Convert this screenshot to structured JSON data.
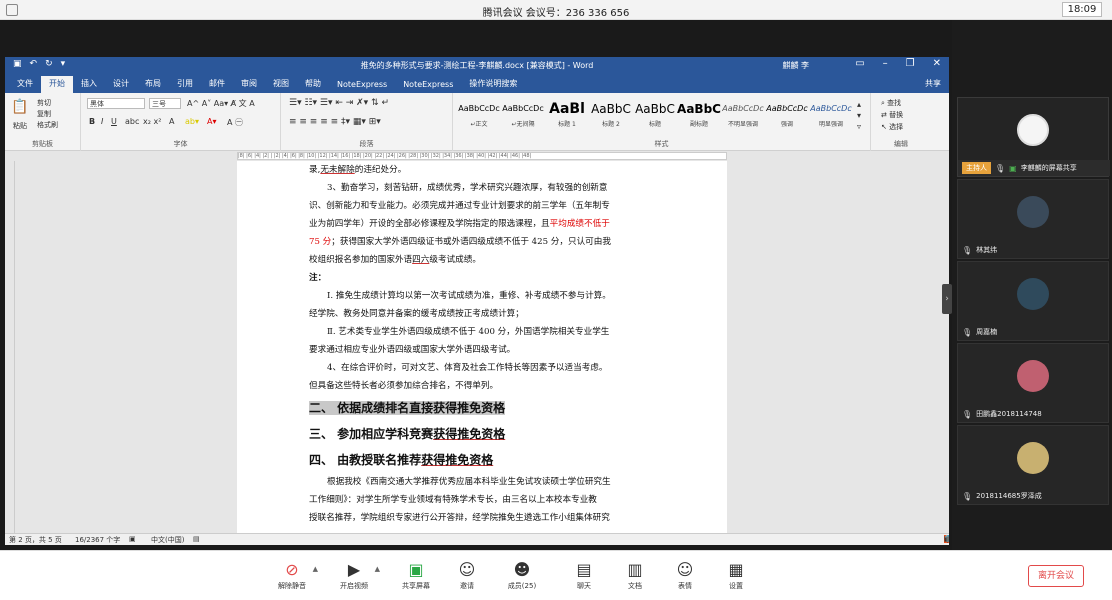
{
  "meeting": {
    "title": "腾讯会议 会议号：236 336 656",
    "clock": "18:09"
  },
  "word": {
    "title": "推免的多种形式与要求-测绘工程-李麒麟.docx [兼容模式] - Word",
    "user": "麒麟 李",
    "tabs": [
      "文件",
      "开始",
      "插入",
      "设计",
      "布局",
      "引用",
      "邮件",
      "审阅",
      "视图",
      "帮助",
      "NoteExpress",
      "NoteExpress",
      "操作说明搜索"
    ],
    "share": "共享",
    "ribbon": {
      "clipboard": {
        "paste": "粘贴",
        "cut": "剪切",
        "copy": "复制",
        "format_painter": "格式刷",
        "label": "剪贴板"
      },
      "font": {
        "name": "黑体",
        "size": "三号",
        "label": "字体"
      },
      "paragraph": {
        "label": "段落"
      },
      "styles": {
        "label": "样式",
        "items": [
          {
            "sample": "AaBbCcDc",
            "name": "↵正文"
          },
          {
            "sample": "AaBbCcDc",
            "name": "↵无间隔"
          },
          {
            "sample": "AaBl",
            "name": "标题 1"
          },
          {
            "sample": "AaBbC",
            "name": "标题 2"
          },
          {
            "sample": "AaBbC",
            "name": "标题"
          },
          {
            "sample": "AaBbC",
            "name": "副标题"
          },
          {
            "sample": "AaBbCcDc",
            "name": "不明显强调"
          },
          {
            "sample": "AaBbCcDc",
            "name": "强调"
          },
          {
            "sample": "AaBbCcDc",
            "name": "明显强调"
          }
        ]
      },
      "editing": {
        "find": "查找",
        "replace": "替换",
        "select": "选择",
        "label": "编辑"
      }
    },
    "ruler": "|8| |6| |4| |2| | |2| |4| |6| |8| |10| |12| |14| |16| |18| |20| |22| |24| |26| |28| |30| |32| |34| |36| |38| |40| |42| |44| |46| |48|",
    "doc": {
      "p1_a": "录,",
      "p1_b": "无未解除",
      "p1_c": "的违纪处分。",
      "p2": "3、勤奋学习，刻苦钻研，成绩优秀，学术研究兴趣浓厚，有较强的创新意",
      "p3": "识、创新能力和专业能力。必须完成并通过专业计划要求的前三学年（五年制专",
      "p4_a": "业为前四学年）开设的全部必修课程及学院指定的限选课程，且",
      "p4_b": "平均成绩不低于",
      "p5_a": "75 分",
      "p5_b": "；获得国家大学外语四级证书或外语四级成绩不低于 425 分，只认可由我",
      "p6_a": "校组织报名参加的国家外语",
      "p6_b": "四六",
      "p6_c": "级考试成绩。",
      "note": "注：",
      "n1": "Ⅰ. 推免生成绩计算均以第一次考试成绩为准，重修、补考成绩不参与计算。",
      "n1b": "经学院、教务处同意并备案的缓考成绩按正考成绩计算；",
      "n2": "Ⅱ. 艺术类专业学生外语四级成绩不低于 400 分，外国语学院相关专业学生",
      "n2b": "要求通过相应专业外语四级或国家大学外语四级考试。",
      "p7": "4、在综合评价时，可对文艺、体育及社会工作特长等因素予以适当考虑。",
      "p7b": "但具备这些特长者必须参加综合排名，不得单列。",
      "h2": "二、 依据成绩排名直接获得推免资格",
      "h3_a": "三、 参加相应学科竞赛",
      "h3_b": "获得推免资格",
      "h4_a": "四、 由教授联名推荐",
      "h4_b": "获得推免资格",
      "p8": "根据我校《西南交通大学推荐优秀应届本科毕业生免试攻读硕士学位研究生",
      "p9": "工作细则》：对学生所学专业领域有特殊学术专长，由三名以上本校本专业教",
      "p10": "授联名推荐，学院组织专家进行公开答辩，经学院推免生遴选工作小组集体研究"
    },
    "status": {
      "page": "第 2 页，共 5 页",
      "words": "16/2367 个字",
      "lang": "中文(中国)"
    },
    "ime": "中"
  },
  "participants": [
    {
      "name": "李麒麟的屏幕共享",
      "host_badge": "主持人",
      "color": "#f5f5f5"
    },
    {
      "name": "林其纬",
      "color": "#3a4a5a"
    },
    {
      "name": "周嘉楠",
      "color": "#2f4a5c"
    },
    {
      "name": "田鹏鑫2018114748",
      "color": "#c06070"
    },
    {
      "name": "2018114685罗泽成",
      "color": "#c8b070"
    }
  ],
  "toolbar": {
    "unmute": "解除静音",
    "video": "开启视频",
    "share": "共享屏幕",
    "invite": "邀请",
    "members": "成员(25)",
    "chat": "聊天",
    "docs": "文档",
    "reaction": "表情",
    "settings": "设置",
    "leave": "离开会议"
  }
}
